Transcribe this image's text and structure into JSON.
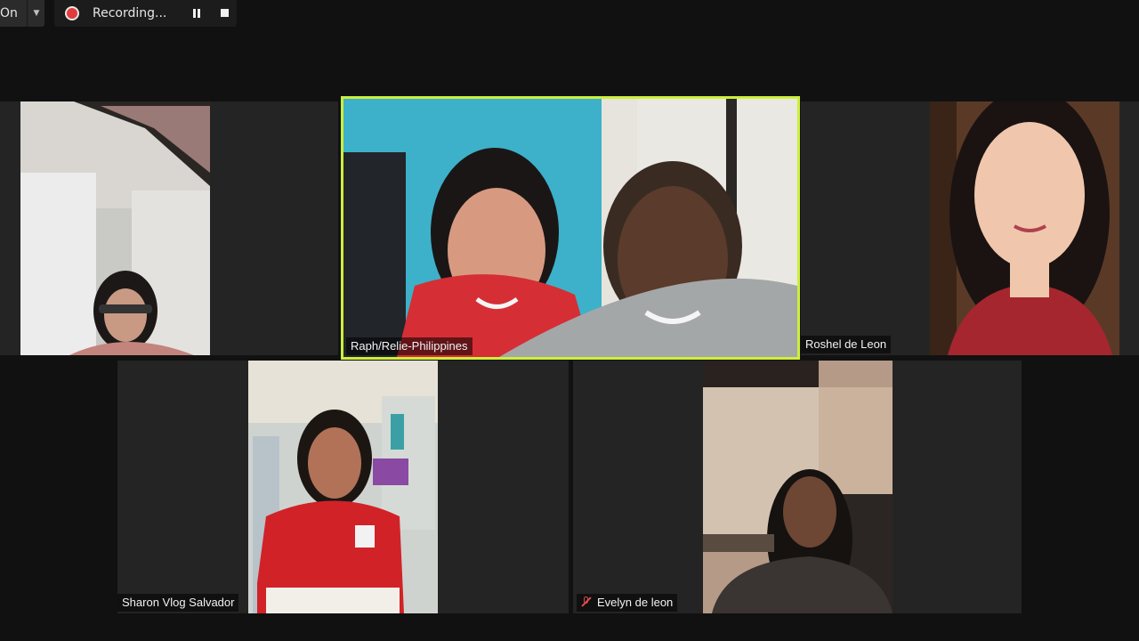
{
  "toolbar": {
    "view_label": "On",
    "recording_label": "Recording..."
  },
  "colors": {
    "active_speaker_border": "#cdef3a",
    "recording_dot": "#e23b3b",
    "muted_icon": "#e04b4b"
  },
  "participants": [
    {
      "name": ""
    },
    {
      "name": "Raph/Relie-Philippines",
      "active_speaker": true
    },
    {
      "name": "Roshel de Leon"
    },
    {
      "name": "Sharon Vlog Salvador"
    },
    {
      "name": "Evelyn de leon",
      "muted": true
    }
  ]
}
